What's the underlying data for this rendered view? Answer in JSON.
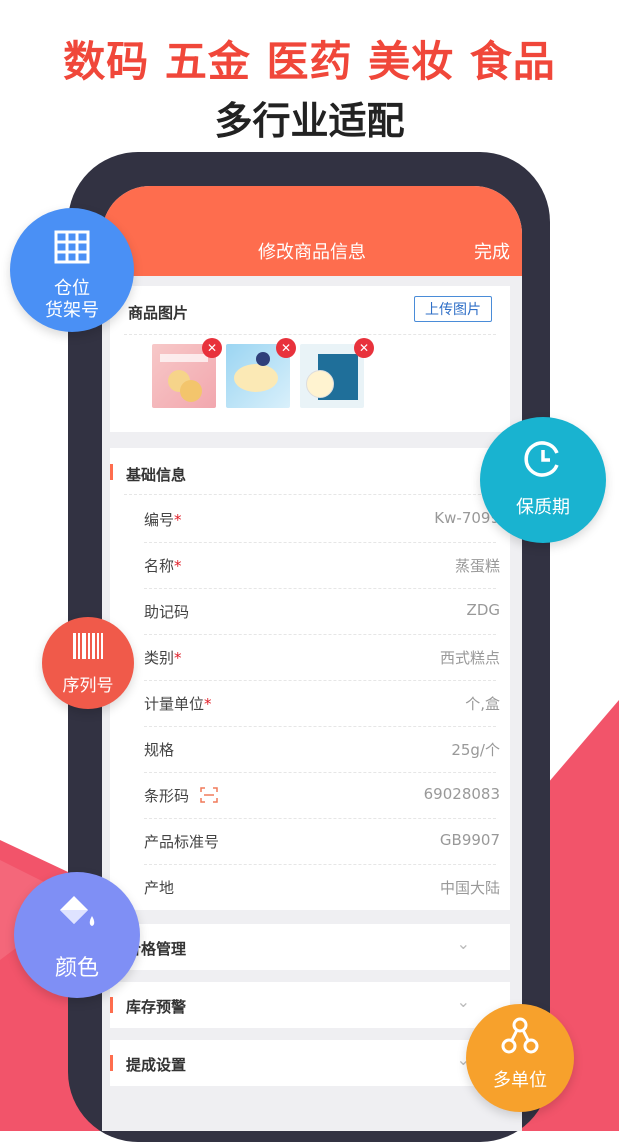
{
  "headline": {
    "words": [
      "数码",
      "五金",
      "医药",
      "美妆",
      "食品"
    ],
    "color": "#f0473a",
    "sub": "多行业适配"
  },
  "nav": {
    "title": "修改商品信息",
    "done": "完成",
    "color": "#fe6d4e"
  },
  "images_section": {
    "title": "商品图片",
    "upload_label": "上传图片"
  },
  "basic": {
    "title": "基础信息",
    "rows": [
      {
        "label": "编号",
        "required": true,
        "value": "Kw-7099"
      },
      {
        "label": "名称",
        "required": true,
        "value": "蒸蛋糕"
      },
      {
        "label": "助记码",
        "required": false,
        "value": "ZDG"
      },
      {
        "label": "类别",
        "required": true,
        "value": "西式糕点"
      },
      {
        "label": "计量单位",
        "required": true,
        "value": "个,盒"
      },
      {
        "label": "规格",
        "required": false,
        "value": "25g/个"
      },
      {
        "label": "条形码",
        "required": false,
        "value": "69028083",
        "icon": "scan-icon"
      },
      {
        "label": "产品标准号",
        "required": false,
        "value": "GB9907"
      },
      {
        "label": "产地",
        "required": false,
        "value": "中国大陆"
      }
    ]
  },
  "folds": {
    "price": "价格管理",
    "stock": "库存预警",
    "commission": "提成设置"
  },
  "badges": {
    "location": {
      "line1": "仓位",
      "line2": "货架号",
      "color": "#4a90f5"
    },
    "shelf_life": {
      "label": "保质期",
      "color": "#19b3d0"
    },
    "serial": {
      "label": "序列号",
      "color": "#f05a4a"
    },
    "color_attr": {
      "label": "颜色",
      "color": "#7f8ff5"
    },
    "multi_unit": {
      "label": "多单位",
      "color": "#f7a12c"
    }
  },
  "required_mark": "*"
}
